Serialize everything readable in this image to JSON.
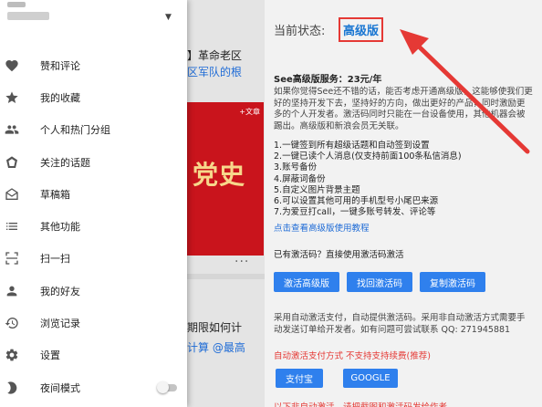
{
  "feed": {
    "line1": "】革命老区",
    "line2": "区军队的根",
    "image_tag": "+文章",
    "image_big_text": "党史",
    "dots": "...",
    "line3": "期限如何计",
    "line4": "计算 @最高"
  },
  "drawer": {
    "menu": [
      {
        "label": "赞和评论",
        "icon": "heart-icon"
      },
      {
        "label": "我的收藏",
        "icon": "star-icon"
      },
      {
        "label": "个人和热门分组",
        "icon": "group-icon"
      },
      {
        "label": "关注的话题",
        "icon": "tag-icon"
      },
      {
        "label": "草稿箱",
        "icon": "drafts-icon"
      },
      {
        "label": "其他功能",
        "icon": "list-icon"
      },
      {
        "label": "扫一扫",
        "icon": "scan-icon"
      },
      {
        "label": "我的好友",
        "icon": "person-icon"
      },
      {
        "label": "浏览记录",
        "icon": "history-icon"
      },
      {
        "label": "设置",
        "icon": "gear-icon"
      },
      {
        "label": "夜间模式",
        "icon": "moon-icon",
        "toggle": false
      }
    ]
  },
  "panel": {
    "status_label": "当前状态:",
    "status_value": "高级版",
    "price": "See高级版服务：23元/年",
    "description": "如果你觉得See还不错的话，能否考虑开通高级版，这能够使我们更好的坚持开发下去，坚持好的方向，做出更好的产品，同时激励更多的个人开发者。激活码同时只能在一台设备使用，其他机器会被踢出。高级版和新浪会员无关联。",
    "features": [
      "1.一键签到所有超级话题和自动签到设置",
      "2.一键已读个人消息(仅支持前面100条私信消息)",
      "3.账号备份",
      "4.屏蔽词备份",
      "5.自定义图片背景主题",
      "6.可以设置其他可用的手机型号小尾巴来源",
      "7.为爱豆打call，一键多账号转发、评论等"
    ],
    "tutorial_link": "点击查看高级版使用教程",
    "have_code": "已有激活码？直接使用激活码激活",
    "buttons": {
      "activate": "激活高级版",
      "retrieve": "找回激活码",
      "copy": "复制激活码"
    },
    "auto_desc": "采用自动激活支付，自动提供激活码。采用非自动激活方式需要手动发送订单给开发者。如有问题可尝试联系 QQ: 271945881",
    "red_note": "自动激活支付方式 不支持支持续费(推荐)",
    "pay_buttons": {
      "alipay": "支付宝",
      "google": "GOOGLE"
    },
    "more_text": "以下非自动激活，请把截图和激活码发给作者"
  },
  "colors": {
    "accent": "#2f80ed",
    "link": "#1e6bd6",
    "status_blue": "#1976d2",
    "highlight_red": "#e53935"
  }
}
